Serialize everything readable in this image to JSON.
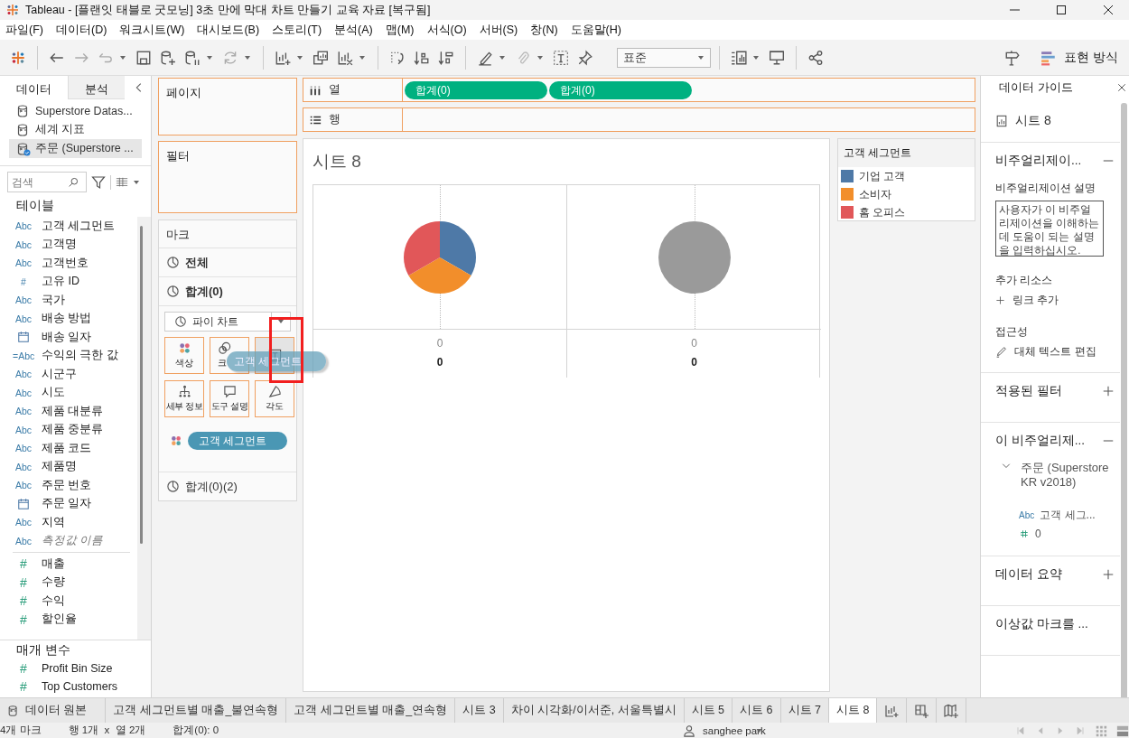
{
  "window": {
    "title": "Tableau - [플랜잇 태블로 굿모닝] 3초 만에 막대 차트 만들기 교육 자료 [복구됨]"
  },
  "menu": [
    "파일(F)",
    "데이터(D)",
    "워크시트(W)",
    "대시보드(B)",
    "스토리(T)",
    "분석(A)",
    "맵(M)",
    "서식(O)",
    "서버(S)",
    "창(N)",
    "도움말(H)"
  ],
  "toolbar": {
    "fit_dropdown": "표준",
    "show_me": "표현 방식"
  },
  "data_pane": {
    "tabs": [
      {
        "label": "데이터",
        "selected": true
      },
      {
        "label": "분석",
        "selected": false
      }
    ],
    "sources": [
      {
        "name": "Superstore Datas...",
        "selected": false
      },
      {
        "name": "세계 지표",
        "selected": false
      },
      {
        "name": "주문 (Superstore ...",
        "selected": true
      }
    ],
    "search": {
      "placeholder": "검색"
    },
    "tables_title": "테이블",
    "fields": [
      {
        "kind": "text",
        "measure": false,
        "mark": "Abc",
        "name": "고객 세그먼트",
        "italic": false
      },
      {
        "kind": "text",
        "measure": false,
        "mark": "Abc",
        "name": "고객명",
        "italic": false
      },
      {
        "kind": "text",
        "measure": false,
        "mark": "Abc",
        "name": "고객번호",
        "italic": false
      },
      {
        "kind": "text",
        "measure": false,
        "mark": "#",
        "name": "고유 ID",
        "italic": false
      },
      {
        "kind": "text",
        "measure": false,
        "mark": "Abc",
        "name": "국가",
        "italic": false
      },
      {
        "kind": "text",
        "measure": false,
        "mark": "Abc",
        "name": "배송 방법",
        "italic": false
      },
      {
        "kind": "date",
        "measure": false,
        "name": "배송 일자",
        "italic": false
      },
      {
        "kind": "text",
        "measure": false,
        "mark": "=Abc",
        "name": "수익의 극한 값",
        "italic": false
      },
      {
        "kind": "text",
        "measure": false,
        "mark": "Abc",
        "name": "시군구",
        "italic": false
      },
      {
        "kind": "text",
        "measure": false,
        "mark": "Abc",
        "name": "시도",
        "italic": false
      },
      {
        "kind": "text",
        "measure": false,
        "mark": "Abc",
        "name": "제품 대분류",
        "italic": false
      },
      {
        "kind": "text",
        "measure": false,
        "mark": "Abc",
        "name": "제품 중분류",
        "italic": false
      },
      {
        "kind": "text",
        "measure": false,
        "mark": "Abc",
        "name": "제품 코드",
        "italic": false
      },
      {
        "kind": "text",
        "measure": false,
        "mark": "Abc",
        "name": "제품명",
        "italic": false
      },
      {
        "kind": "text",
        "measure": false,
        "mark": "Abc",
        "name": "주문 번호",
        "italic": false
      },
      {
        "kind": "date",
        "measure": false,
        "name": "주문 일자",
        "italic": false
      },
      {
        "kind": "text",
        "measure": false,
        "mark": "Abc",
        "name": "지역",
        "italic": false
      },
      {
        "kind": "text",
        "measure": false,
        "mark": "Abc",
        "name": "측정값 이름",
        "italic": true
      },
      {
        "kind": "separator"
      },
      {
        "kind": "text",
        "measure": true,
        "mark": "#",
        "name": "매출",
        "italic": false
      },
      {
        "kind": "text",
        "measure": true,
        "mark": "#",
        "name": "수량",
        "italic": false
      },
      {
        "kind": "text",
        "measure": true,
        "mark": "#",
        "name": "수익",
        "italic": false
      },
      {
        "kind": "text",
        "measure": true,
        "mark": "#",
        "name": "할인율",
        "italic": false
      }
    ],
    "parameters_title": "매개 변수",
    "parameters": [
      {
        "mark": "#",
        "name": "Profit Bin Size"
      },
      {
        "mark": "#",
        "name": "Top Customers"
      }
    ]
  },
  "shelves": {
    "pages": "페이지",
    "filters": "필터",
    "columns": {
      "label": "열",
      "pills": [
        "합계(0)",
        "합계(0)"
      ]
    },
    "rows": {
      "label": "행"
    }
  },
  "marks": {
    "title": "마크",
    "all_card": "전체",
    "active_card": {
      "label": "합계(0)",
      "mark_type": "파이 차트",
      "buttons": [
        {
          "kind": "color",
          "label": "색상"
        },
        {
          "kind": "size",
          "label": "크"
        },
        {
          "kind": "label"
        },
        {
          "kind": "detail",
          "label": "세부 정보"
        },
        {
          "kind": "tooltip",
          "label": "도구 설명"
        },
        {
          "kind": "angle",
          "label": "각도"
        }
      ],
      "encodings": [
        {
          "kind": "color",
          "field": "고객 세그먼트"
        }
      ]
    },
    "other_cards": [
      "합계(0)(2)"
    ],
    "drag_pill": "고객 세그먼트"
  },
  "view": {
    "title": "시트 8",
    "columns": [
      {
        "kind": "pie",
        "axis_value": "0",
        "total": "0"
      },
      {
        "kind": "circle",
        "axis_value": "0",
        "total": "0"
      }
    ],
    "legend": {
      "title": "고객 세그먼트",
      "items": [
        {
          "label": "기업 고객",
          "color": "#4e79a7"
        },
        {
          "label": "소비자",
          "color": "#f28e2b"
        },
        {
          "label": "홈 오피스",
          "color": "#e15759"
        }
      ]
    }
  },
  "guide": {
    "title": "데이터 가이드",
    "sheet": "시트 8",
    "sections": [
      {
        "kind": "viz",
        "title": "비주얼리제이...",
        "expanded": true,
        "description_label": "비주얼리제이션 설명",
        "description_placeholder": "사용자가 이 비주얼리제이션을 이해하는 데 도움이 되는 설명을 입력하십시오.",
        "resources_title": "추가 리소스",
        "add_link": "링크 추가",
        "accessibility_title": "접근성",
        "alt_text": "대체 텍스트 편집"
      },
      {
        "kind": "collapsible",
        "title": "적용된 필터",
        "expanded": false
      },
      {
        "kind": "fields",
        "title": "이 비주얼리제...",
        "expanded": true,
        "tree": [
          {
            "label": "주문 (Superstore KR v2018)",
            "expanded": true,
            "children": [
              {
                "kind": "text",
                "mark": "Abc",
                "label": "고객 세그..."
              },
              {
                "kind": "measure",
                "label": "0"
              }
            ]
          }
        ]
      },
      {
        "kind": "collapsible",
        "title": "데이터 요약",
        "expanded": false
      },
      {
        "kind": "plain",
        "title": "이상값 마크를 ..."
      }
    ]
  },
  "sheet_tabs": {
    "data_source": "데이터 원본",
    "tabs": [
      {
        "label": "고객 세그먼트별 매출_불연속형",
        "selected": false
      },
      {
        "label": "고객 세그먼트별 매출_연속형",
        "selected": false
      },
      {
        "label": "시트 3",
        "selected": false
      },
      {
        "label": "차이 시각화/이서준, 서울특별시",
        "selected": false
      },
      {
        "label": "시트 5",
        "selected": false
      },
      {
        "label": "시트 6",
        "selected": false
      },
      {
        "label": "시트 7",
        "selected": false
      },
      {
        "label": "시트 8",
        "selected": true
      }
    ]
  },
  "status": {
    "items": [
      "4개 마크",
      "행 1개  x  열 2개",
      "합계(0): 0"
    ],
    "user": "sanghee park"
  }
}
